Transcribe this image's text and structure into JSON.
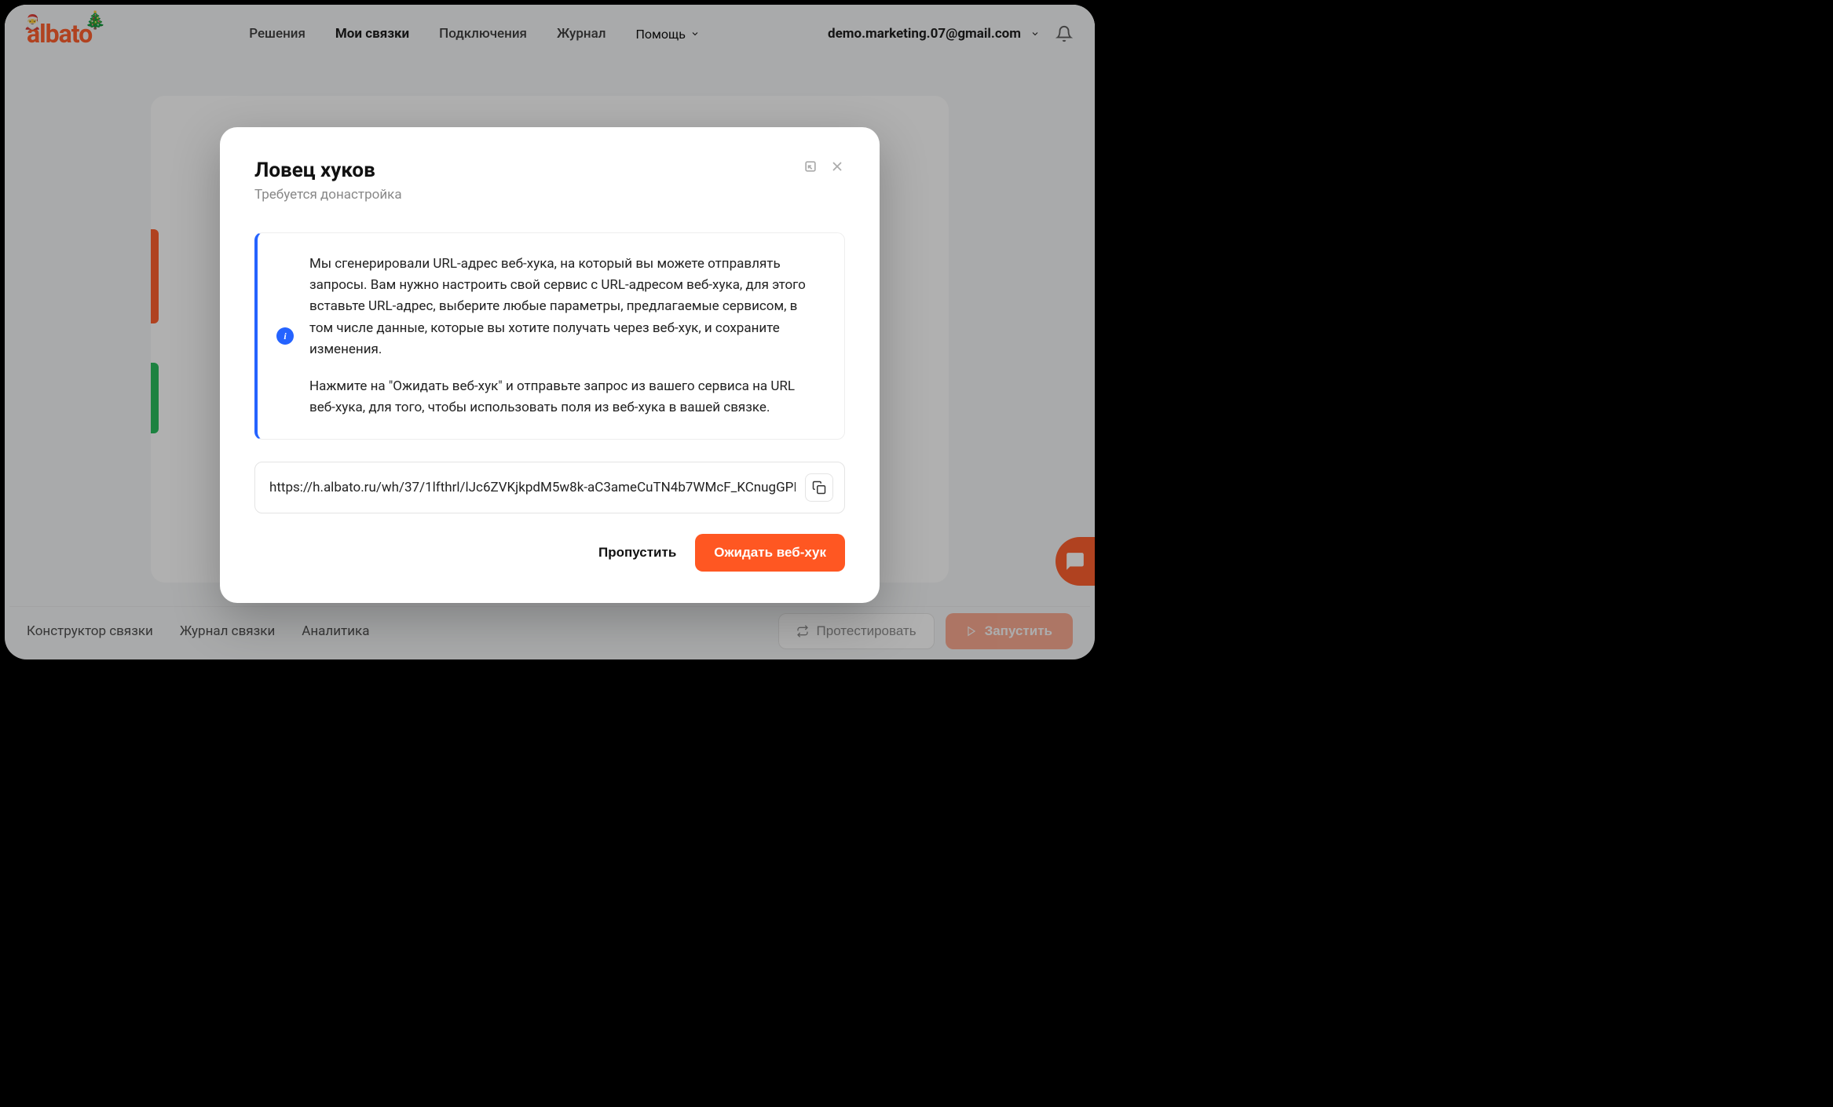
{
  "logo_text": "albato",
  "nav": {
    "solutions": "Решения",
    "bundles": "Мои связки",
    "connections": "Подключения",
    "journal": "Журнал",
    "help": "Помощь"
  },
  "user_email": "demo.marketing.07@gmail.com",
  "footer": {
    "constructor": "Конструктор связки",
    "journal": "Журнал связки",
    "analytics": "Аналитика",
    "test": "Протестировать",
    "run": "Запустить"
  },
  "modal": {
    "title": "Ловец хуков",
    "subtitle": "Требуется донастройка",
    "info_p1": "Мы сгенерировали URL-адрес веб-хука, на который вы можете отправлять запросы. Вам нужно настроить свой сервис с URL-адресом веб-хука, для этого вставьте URL-адрес, выберите любые параметры, предлагаемые сервисом, в том числе данные, которые вы хотите получать через веб-хук, и сохраните изменения.",
    "info_p2": "Нажмите на \"Ожидать веб-хук\" и отправьте запрос из вашего сервиса на URL веб-хука, для того, чтобы использовать поля из веб-хука в вашей связке.",
    "url": "https://h.albato.ru/wh/37/1lfthrl/lJc6ZVKjkpdM5w8k-aC3ameCuTN4b7WMcF_KCnugGPI/",
    "skip": "Пропустить",
    "wait": "Ожидать веб-хук"
  }
}
